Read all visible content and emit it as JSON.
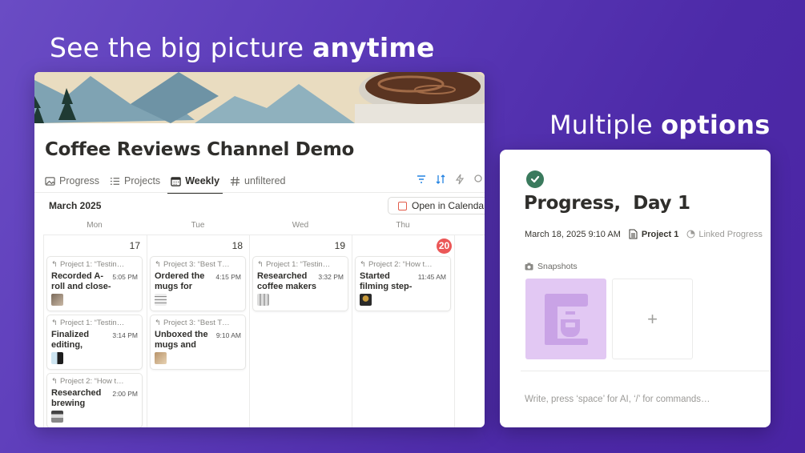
{
  "headlines": {
    "left_prefix": "See the big picture ",
    "left_bold": "anytime",
    "right_prefix": "Multiple ",
    "right_bold": "options"
  },
  "database": {
    "title": "Coffee Reviews Channel Demo",
    "tabs": [
      {
        "label": "Progress",
        "icon": "image-icon"
      },
      {
        "label": "Projects",
        "icon": "list-icon"
      },
      {
        "label": "Weekly",
        "icon": "calendar-icon",
        "active": true
      },
      {
        "label": "unfiltered",
        "icon": "hash-icon"
      }
    ],
    "month": "March 2025",
    "open_calendar_label": "Open in Calendar",
    "weekdays": [
      "Mon",
      "Tue",
      "Wed",
      "Thu"
    ],
    "days": [
      "17",
      "18",
      "19",
      "20"
    ],
    "today_color": "#eb5757",
    "events": {
      "mon": [
        {
          "relation": "Project 1: “Testin…",
          "title": "Recorded A-roll and close-up…",
          "time": "5:05 PM"
        },
        {
          "relation": "Project 1: “Testin…",
          "title": "Finalized editing, uploaded,…",
          "time": "3:14 PM"
        },
        {
          "relation": "Project 2: “How t…",
          "title": "Researched brewing techniques",
          "time": "2:00 PM"
        }
      ],
      "tue": [
        {
          "relation": "Project 3: “Best T…",
          "title": "Ordered the mugs for testing a…",
          "time": "4:15 PM"
        },
        {
          "relation": "Project 3: “Best T…",
          "title": "Unboxed the mugs and started…",
          "time": "9:10 AM"
        }
      ],
      "wed": [
        {
          "relation": "Project 1: “Testin…",
          "title": "Researched coffee makers and…",
          "time": "3:32 PM"
        }
      ],
      "thu": [
        {
          "relation": "Project 2: “How t…",
          "title": "Started filming step-by-st…",
          "time": "11:45 AM"
        }
      ]
    }
  },
  "page": {
    "title": "Progress,  Day 1",
    "status_color": "#3a7a5d",
    "date": "March 18, 2025 9:10 AM",
    "project": "Project 1",
    "linked": "Linked Progress",
    "snapshots_label": "Snapshots",
    "add_symbol": "+",
    "editor_placeholder": "Write, press ‘space’ for AI, ‘/’ for commands…"
  }
}
